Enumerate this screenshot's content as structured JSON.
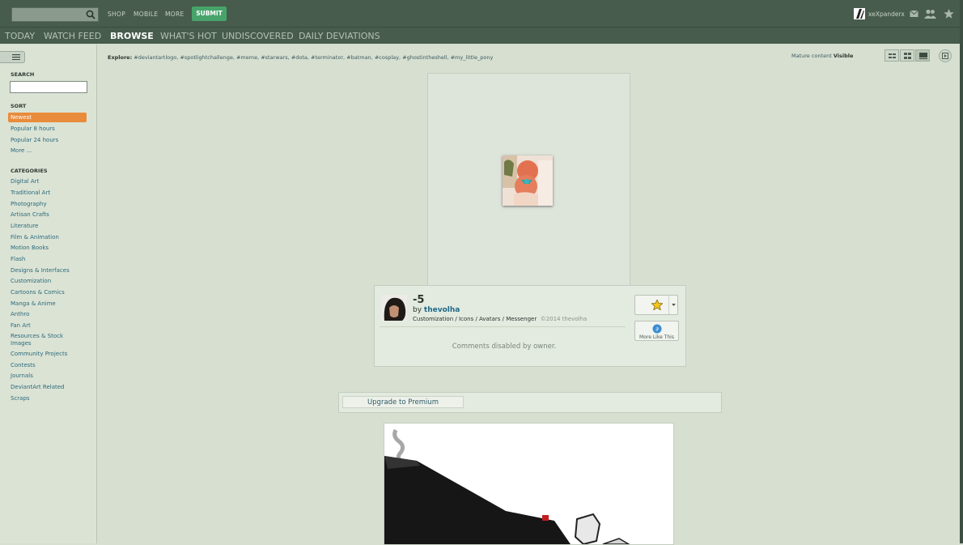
{
  "topbar": {
    "search_placeholder": "",
    "links": [
      "SHOP",
      "MOBILE",
      "MORE"
    ],
    "submit_label": "SUBMIT",
    "username": "xeXpanderx"
  },
  "nav": {
    "tabs": [
      "TODAY",
      "WATCH FEED",
      "BROWSE",
      "WHAT'S HOT",
      "UNDISCOVERED",
      "DAILY DEVIATIONS"
    ],
    "active": "BROWSE"
  },
  "sidebar": {
    "search_heading": "SEARCH",
    "sort_heading": "SORT",
    "sort_items": [
      "Newest",
      "Popular 8 hours",
      "Popular 24 hours",
      "More ..."
    ],
    "categories_heading": "CATEGORIES",
    "categories": [
      "Digital Art",
      "Traditional Art",
      "Photography",
      "Artisan Crafts",
      "Literature",
      "Film & Animation",
      "Motion Books",
      "Flash",
      "Designs & Interfaces",
      "Customization",
      "Cartoons & Comics",
      "Manga & Anime",
      "Anthro",
      "Fan Art",
      "Resources & Stock Images",
      "Community Projects",
      "Contests",
      "Journals",
      "DeviantArt Related",
      "Scraps"
    ]
  },
  "explore": {
    "label": "Explore:",
    "tags": [
      "#deviantartlogo",
      "#spotlightchallenge",
      "#meme",
      "#starwars",
      "#dota",
      "#terminator",
      "#batman",
      "#cosplay",
      "#ghostintheshell",
      "#my_little_pony"
    ]
  },
  "mature": {
    "label": "Mature content",
    "value": "Visible"
  },
  "deviation": {
    "title": "-5",
    "by": "by",
    "author": "thevolha",
    "category_path": "Customization / Icons / Avatars / Messenger",
    "copyright": "©2014 thevolha",
    "comments_text": "Comments disabled by owner.",
    "more_like_this": "More Like This"
  },
  "premium": {
    "label": "Upgrade to Premium"
  },
  "colors": {
    "accent_green": "#47a36a",
    "sort_active": "#e88c3c",
    "topbar": "#475c4d"
  }
}
